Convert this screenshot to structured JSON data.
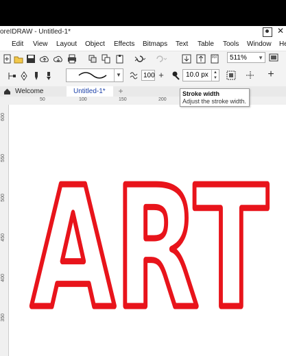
{
  "window": {
    "title": "oreIDRAW - Untitled-1*",
    "close_label": "✕"
  },
  "menu": [
    "Edit",
    "View",
    "Layout",
    "Object",
    "Effects",
    "Bitmaps",
    "Text",
    "Table",
    "Tools",
    "Window",
    "He"
  ],
  "toolbar": {
    "zoom_value": "511%",
    "smoothing_value": "100",
    "stroke_width_value": "10.0 px"
  },
  "tabs": {
    "welcome": "Welcome Screen",
    "document": "Untitled-1*",
    "add": "+"
  },
  "tooltip": {
    "title": "Stroke width",
    "body": "Adjust the stroke width."
  },
  "rulers": {
    "horizontal": [
      "50",
      "100",
      "150",
      "200"
    ],
    "vertical": [
      "600",
      "550",
      "500",
      "450",
      "400",
      "350"
    ]
  },
  "canvas": {
    "art_text": "ART",
    "stroke_color": "#e8141b"
  }
}
